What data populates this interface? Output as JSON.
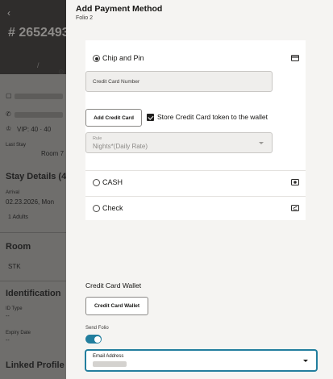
{
  "background": {
    "reservation_number": "# 2652493",
    "vip_label": "VIP: 40 · 40",
    "last_stay_label": "Last Stay",
    "last_stay_value": "Room 7",
    "stay_details_heading": "Stay Details (4",
    "arrival_label": "Arrival",
    "arrival_value": "02.23.2026, Mon",
    "adults_label": "1 Adults",
    "room_heading": "Room",
    "room_value": "STK",
    "identification_heading": "Identification",
    "id_type_label": "ID Type",
    "id_type_value": "--",
    "expiry_label": "Expiry Date",
    "expiry_value": "--",
    "linked_profile_heading": "Linked Profile"
  },
  "drawer": {
    "title": "Add Payment Method",
    "subtitle": "Folio 2",
    "methods": [
      {
        "label": "Chip and Pin",
        "selected": true,
        "icon": "credit-card-icon"
      },
      {
        "label": "CASH",
        "selected": false,
        "icon": "cash-icon"
      },
      {
        "label": "Check",
        "selected": false,
        "icon": "check-icon"
      }
    ],
    "credit_card_number_placeholder": "Credit Card Number",
    "add_credit_card_label": "Add Credit Card",
    "store_token_label": "Store Credit Card token to the wallet",
    "store_token_checked": true,
    "rule_label": "Rule",
    "rule_value": "Nights*(Daily Rate)",
    "wallet_title": "Credit Card Wallet",
    "wallet_button_label": "Credit Card Wallet",
    "send_folio_label": "Send Folio",
    "send_folio_enabled": true,
    "email_label": "Email Address"
  },
  "colors": {
    "accent": "#227e9e",
    "drawer_bg": "#f5f4f2",
    "overlay_header": "#2f2d2c"
  }
}
